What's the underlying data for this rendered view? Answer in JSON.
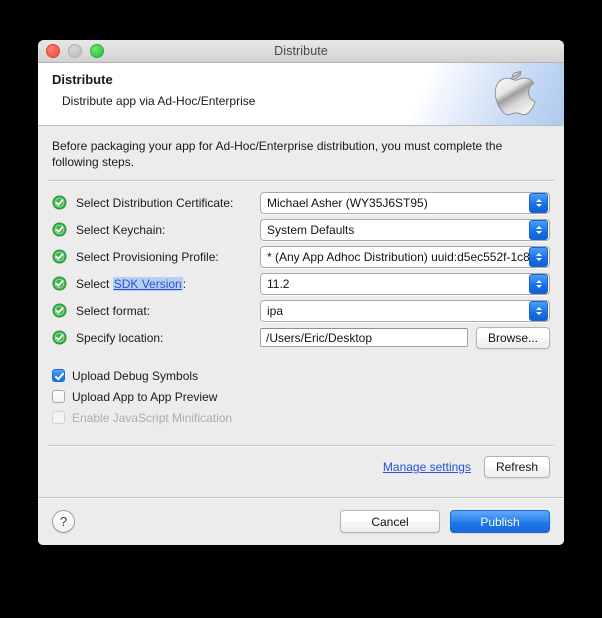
{
  "window": {
    "title": "Distribute",
    "traffic_lights": [
      "close",
      "minimize",
      "zoom"
    ]
  },
  "header": {
    "title": "Distribute",
    "subtitle": "Distribute app via Ad-Hoc/Enterprise",
    "logo": "apple-logo"
  },
  "intro": "Before packaging your app for Ad-Hoc/Enterprise distribution, you must complete the following steps.",
  "form": {
    "rows": [
      {
        "status": "ok",
        "label": "Select Distribution Certificate:",
        "control": "popup",
        "value": "Michael Asher (WY35J6ST95)"
      },
      {
        "status": "ok",
        "label": "Select Keychain:",
        "control": "popup",
        "value": "System Defaults"
      },
      {
        "status": "ok",
        "label": "Select Provisioning Profile:",
        "control": "popup",
        "value": "* (Any App Adhoc Distribution) uuid:d5ec552f-1c8"
      },
      {
        "status": "ok",
        "label_prefix": "Select ",
        "label_link": "SDK Version",
        "label_suffix": ":",
        "control": "popup",
        "value": "11.2"
      },
      {
        "status": "ok",
        "label": "Select format:",
        "control": "popup",
        "value": "ipa"
      },
      {
        "status": "ok",
        "label": "Specify location:",
        "control": "textfield",
        "value": "/Users/Eric/Desktop",
        "button": "Browse..."
      }
    ]
  },
  "checkboxes": [
    {
      "label": "Upload Debug Symbols",
      "checked": true,
      "disabled": false
    },
    {
      "label": "Upload App to App Preview",
      "checked": false,
      "disabled": false
    },
    {
      "label": "Enable JavaScript Minification",
      "checked": false,
      "disabled": true
    }
  ],
  "manage": {
    "link": "Manage settings",
    "refresh_button": "Refresh"
  },
  "footer": {
    "help": "?",
    "cancel_button": "Cancel",
    "publish_button": "Publish"
  },
  "colors": {
    "accent_blue": "#2179ec",
    "link_blue": "#2b4fd8",
    "ok_green": "#3cb54a",
    "window_bg": "#ececec"
  }
}
